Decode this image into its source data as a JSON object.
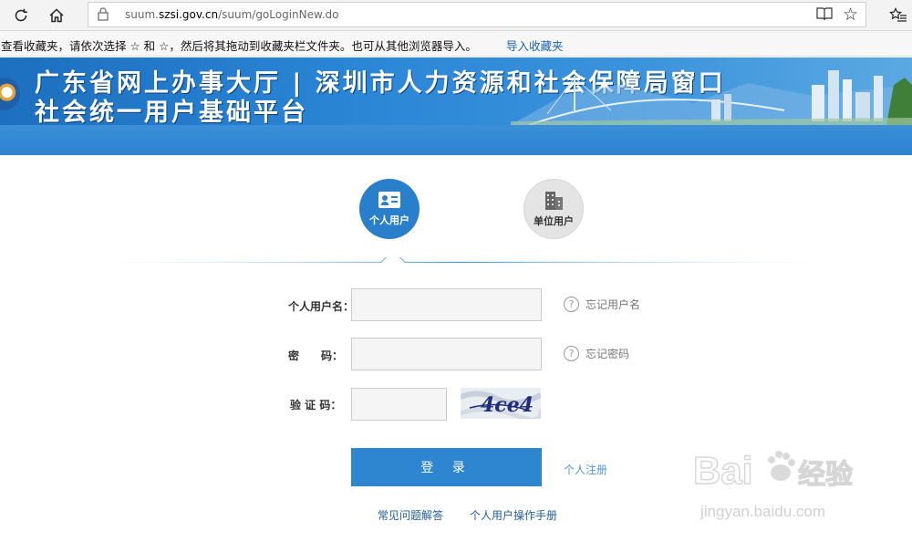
{
  "browser": {
    "url_prefix": "suum.",
    "url_domain": "szsi.gov.cn",
    "url_path": "/suum/goLoginNew.do",
    "icons": [
      "refresh-icon",
      "home-icon",
      "lock-icon",
      "reading-view-icon",
      "favorite-star-icon",
      "favorites-hub-icon"
    ]
  },
  "favbar": {
    "message": "查看收藏夹，请依次选择 ☆ 和 ☆，然后将其拖动到收藏夹栏文件夹。也可从其他浏览器导入。",
    "import_link": "导入收藏夹"
  },
  "banner": {
    "line1": "广东省网上办事大厅 | 深圳市人力资源和社会保障局窗口",
    "line2": "社会统一用户基础平台"
  },
  "tabs": {
    "personal": "个人用户",
    "company": "单位用户"
  },
  "form": {
    "username_label": "个人用户名：",
    "password_label": "密　　码：",
    "captcha_label": "验 证 码：",
    "forgot_username": "忘记用户名",
    "forgot_password": "忘记密码",
    "captcha_text": "4ce4",
    "username_value": "",
    "password_value": "",
    "captcha_value": ""
  },
  "actions": {
    "login": "登 录",
    "register": "个人注册",
    "faq": "常见问题解答",
    "manual": "个人用户操作手册"
  },
  "colors": {
    "primary": "#2f86d0",
    "link": "#1a63b5",
    "banner": "#2b86d6"
  }
}
